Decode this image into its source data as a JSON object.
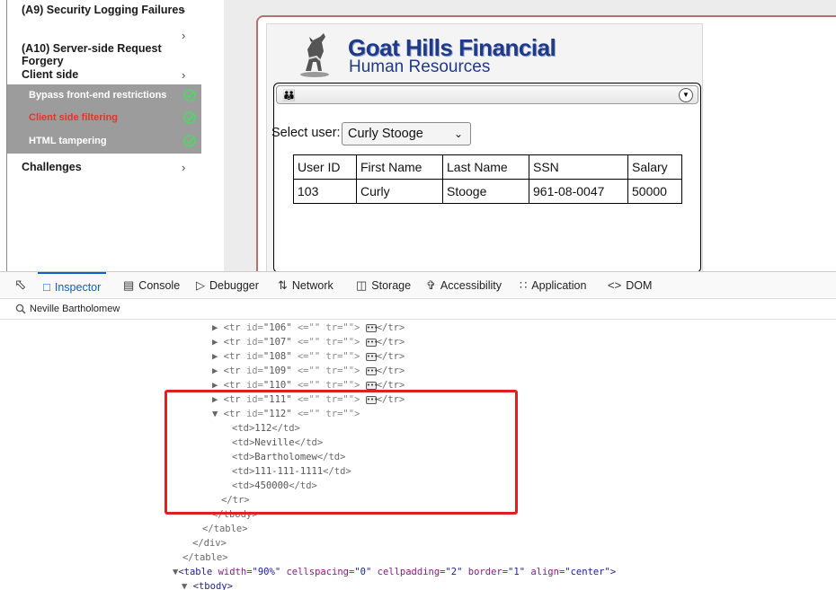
{
  "sidebar": {
    "items": [
      {
        "label": "(A9) Security Logging Failures",
        "chev": "›"
      },
      {
        "label": "(A10) Server-side Request Forgery",
        "chev": "›"
      },
      {
        "label": "Client side",
        "chev": "›"
      },
      {
        "label": "Challenges",
        "chev": "›"
      }
    ],
    "submenu": [
      {
        "label": "Bypass front-end restrictions"
      },
      {
        "label": "Client side filtering"
      },
      {
        "label": "HTML tampering"
      }
    ]
  },
  "lesson": {
    "company": "Goat Hills Financial",
    "department": "Human Resources",
    "select_label": "Select user:",
    "selected_user": "Curly Stooge",
    "table": {
      "headers": [
        "User ID",
        "First Name",
        "Last Name",
        "SSN",
        "Salary"
      ],
      "rows": [
        [
          "103",
          "Curly",
          "Stooge",
          "961-08-0047",
          "50000"
        ]
      ]
    }
  },
  "devtools": {
    "tabs": [
      "Inspector",
      "Console",
      "Debugger",
      "Network",
      "Storage",
      "Accessibility",
      "Application",
      "DOM"
    ],
    "search_value": "Neville Bartholomew",
    "collapsed_rows": [
      "106",
      "107",
      "108",
      "109",
      "110",
      "111"
    ],
    "expanded_row_id": "112",
    "expanded_cells": [
      "112",
      "Neville",
      "Bartholomew",
      "111-111-1111",
      "450000"
    ],
    "lines": {
      "tr_close": "</tr>",
      "tbody_close": "</tbody>",
      "table_close": "</table>",
      "div_close": "</div>",
      "table_close2": "</table>",
      "tbody_open": "<tbody>"
    },
    "table_attrs": {
      "width": "90%",
      "cellspacing": "0",
      "cellpadding": "2",
      "border": "1",
      "align": "center"
    }
  },
  "colors": {
    "accent": "#0b5fcf",
    "highlight_box": "#e02020",
    "active_sub": "#e8322b",
    "submenu_bg": "#9c9c9c",
    "check": "#4cd964"
  }
}
